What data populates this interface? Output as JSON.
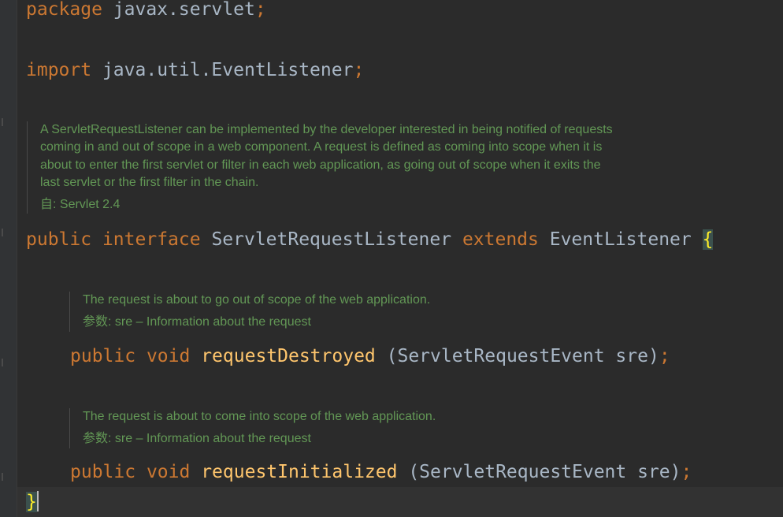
{
  "code": {
    "package_line": {
      "keyword": "package",
      "name": "javax.servlet",
      "semicolon": ";"
    },
    "import_line": {
      "keyword": "import",
      "name": "java.util.EventListener",
      "semicolon": ";"
    },
    "class_doc": {
      "lines": [
        "A ServletRequestListener can be implemented by the developer interested in being notified of requests",
        "coming in and out of scope in a web component. A request is defined as coming into scope when it is",
        "about to enter the first servlet or filter in each web application, as going out of scope when it exits the",
        "last servlet or the first filter in the chain."
      ],
      "since": "自: Servlet 2.4"
    },
    "interface_decl": {
      "modifier": "public",
      "keyword": "interface",
      "name": "ServletRequestListener",
      "extends_keyword": "extends",
      "parent": "EventListener",
      "open_brace": "{"
    },
    "methods": [
      {
        "doc": "The request is about to go out of scope of the web application.",
        "param_doc": "参数: sre – Information about the request",
        "modifier": "public",
        "return_type": "void",
        "name": "requestDestroyed",
        "params": "(ServletRequestEvent sre)",
        "semicolon": ";"
      },
      {
        "doc": "The request is about to come into scope of the web application.",
        "param_doc": "参数: sre – Information about the request",
        "modifier": "public",
        "return_type": "void",
        "name": "requestInitialized",
        "params": "(ServletRequestEvent sre)",
        "semicolon": ";"
      }
    ],
    "close_brace": "}"
  },
  "colors": {
    "background": "#2b2b2b",
    "keyword": "#cc7832",
    "identifier": "#a9b7c6",
    "method": "#ffc66d",
    "doc_comment": "#629755",
    "matched_brace": "#ffef28"
  }
}
